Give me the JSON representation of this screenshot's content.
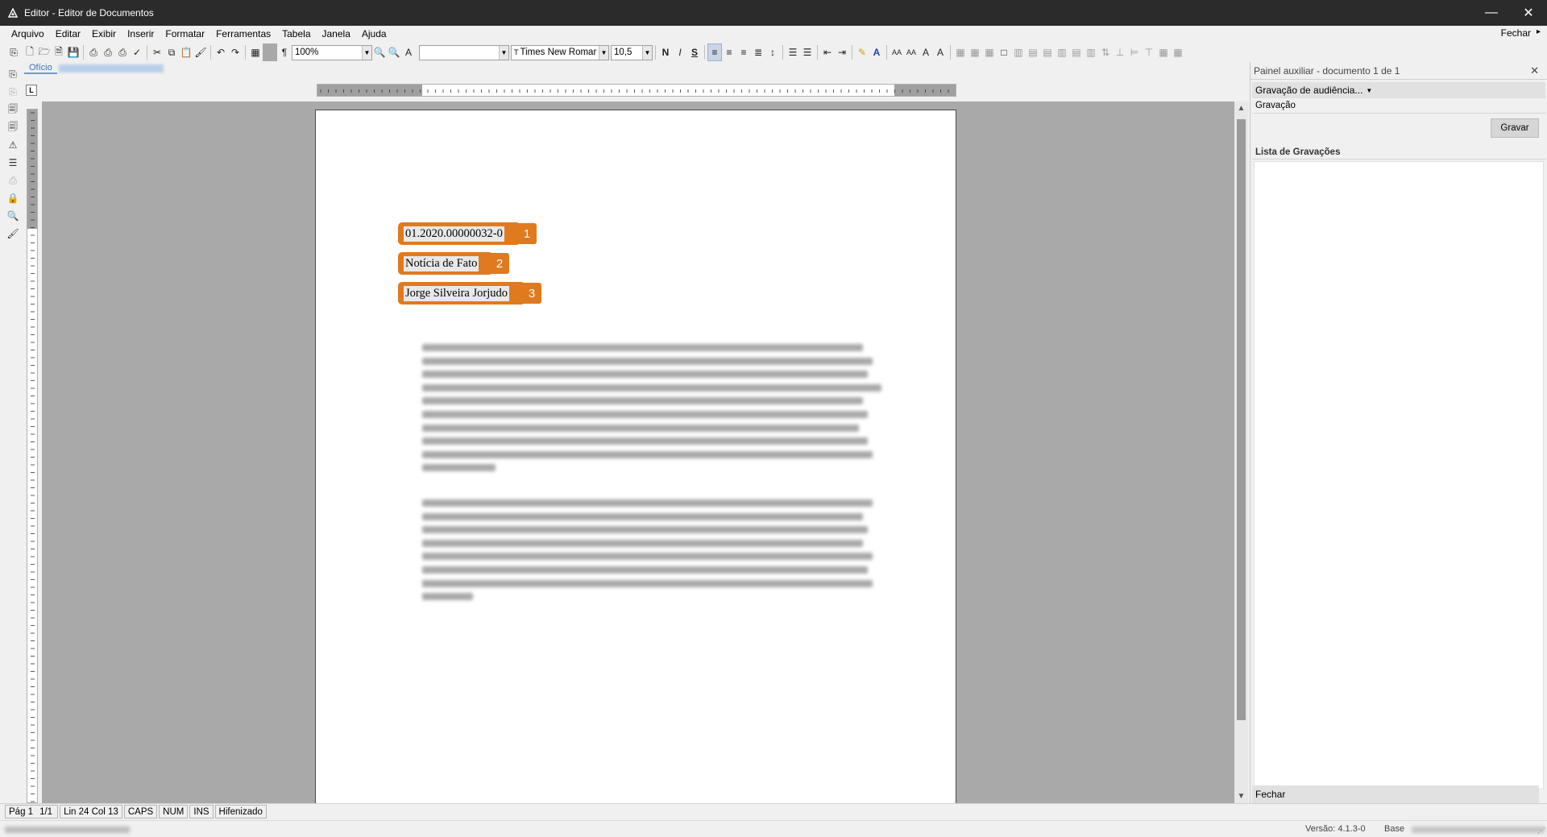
{
  "window": {
    "title": "Editor - Editor de Documentos",
    "minimize": "—",
    "close": "✕"
  },
  "menu": {
    "items": [
      "Arquivo",
      "Editar",
      "Exibir",
      "Inserir",
      "Formatar",
      "Ferramentas",
      "Tabela",
      "Janela",
      "Ajuda"
    ],
    "close_label": "Fechar",
    "close_arrow": "▸"
  },
  "toolbar": {
    "zoom": "100%",
    "style_value": "",
    "font": "Times New Romar",
    "font_size": "10,5",
    "bold": "N",
    "italic": "I",
    "strike": "S",
    "pilcrow": "¶"
  },
  "doc_tab": {
    "label": "Ofício"
  },
  "document": {
    "fields": [
      {
        "text": "01.2020.00000032-0",
        "number": "1"
      },
      {
        "text": "Notícia de Fato",
        "number": "2"
      },
      {
        "text": "Jorge Silveira Jorjudo",
        "number": "3"
      }
    ]
  },
  "ruler": {
    "corner": "L"
  },
  "right_panel": {
    "header": "Painel auxiliar - documento 1 de 1",
    "close": "✕",
    "dropdown": "Gravação de audiência...",
    "section_title": "Gravação",
    "record_button": "Gravar",
    "list_title": "Lista de Gravações",
    "footer": "Fechar"
  },
  "status": {
    "page": "Pág 1",
    "pages": "1/1",
    "position": "Lin 24  Col 13",
    "caps": "CAPS",
    "num": "NUM",
    "ins": "INS",
    "hyphen": "Hifenizado"
  },
  "info": {
    "version": "Versão: 4.1.3-0",
    "base": "Base"
  },
  "colors": {
    "field_accent": "#e07a1f",
    "titlebar": "#2b2b2b",
    "workspace": "#a9a9a9"
  }
}
